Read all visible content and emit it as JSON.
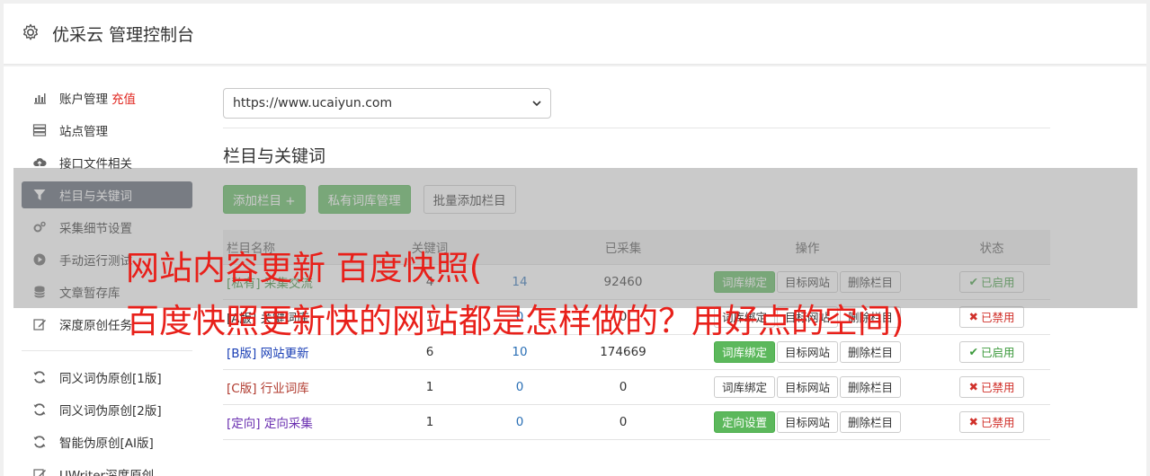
{
  "header": {
    "title": "优采云 管理控制台",
    "icon": "gear-icon"
  },
  "sidebar": {
    "groups": [
      [
        {
          "label": "账户管理",
          "badge": "充值",
          "icon": "bar-chart-icon"
        },
        {
          "label": "站点管理",
          "icon": "server-icon"
        },
        {
          "label": "接口文件相关",
          "icon": "cloud-upload-icon"
        },
        {
          "label": "栏目与关键词",
          "icon": "filter-icon",
          "active": true
        },
        {
          "label": "采集细节设置",
          "icon": "gears-icon"
        },
        {
          "label": "手动运行测试",
          "icon": "play-circle-icon"
        },
        {
          "label": "文章暂存库",
          "icon": "database-icon"
        },
        {
          "label": "深度原创任务",
          "icon": "edit-icon"
        }
      ],
      [
        {
          "label": "同义词伪原创[1版]",
          "icon": "refresh-icon"
        },
        {
          "label": "同义词伪原创[2版]",
          "icon": "refresh-icon"
        },
        {
          "label": "智能伪原创[AI版]",
          "icon": "refresh-icon"
        },
        {
          "label": "UWriter深度原创",
          "icon": "edit-icon"
        }
      ]
    ]
  },
  "site_select": {
    "value": "https://www.ucaiyun.com"
  },
  "section_title": "栏目与关键词",
  "buttons": {
    "add_column": "添加栏目 +",
    "private_lib": "私有词库管理",
    "batch_add": "批量添加栏目"
  },
  "table": {
    "headers": [
      "栏目名称",
      "关键词",
      "已采集",
      "操作",
      "状态"
    ],
    "rows": [
      {
        "tag": "[私有]",
        "name": "采集交流",
        "kw": "4",
        "col": "14",
        "collected": "92460",
        "op1": "词库绑定",
        "op2": "目标网站",
        "op3": "删除栏目",
        "status": "已启用",
        "on": true,
        "op1_green": true,
        "color": "#3a8a3a"
      },
      {
        "tag": "[A版]",
        "name": "关键词库",
        "kw": "1",
        "col": "0",
        "collected": "0",
        "op1": "词库绑定",
        "op2": "目标网站",
        "op3": "删除栏目",
        "status": "已禁用",
        "on": false,
        "op1_green": false,
        "color": "#333333"
      },
      {
        "tag": "[B版]",
        "name": "网站更新",
        "kw": "6",
        "col": "10",
        "collected": "174669",
        "op1": "词库绑定",
        "op2": "目标网站",
        "op3": "删除栏目",
        "status": "已启用",
        "on": true,
        "op1_green": true,
        "color": "#1a3fb5"
      },
      {
        "tag": "[C版]",
        "name": "行业词库",
        "kw": "1",
        "col": "0",
        "collected": "0",
        "op1": "词库绑定",
        "op2": "目标网站",
        "op3": "删除栏目",
        "status": "已禁用",
        "on": false,
        "op1_green": false,
        "color": "#b03a2e"
      },
      {
        "tag": "[定向]",
        "name": "定向采集",
        "kw": "1",
        "col": "0",
        "collected": "0",
        "op1": "定向设置",
        "op2": "目标网站",
        "op3": "删除栏目",
        "status": "已禁用",
        "on": false,
        "op1_green": true,
        "color": "#6a2fb0"
      }
    ]
  },
  "overlay": {
    "line1": "网站内容更新 百度快照(",
    "line2": "百度快照更新快的网站都是怎样做的？用好点的空间)"
  }
}
